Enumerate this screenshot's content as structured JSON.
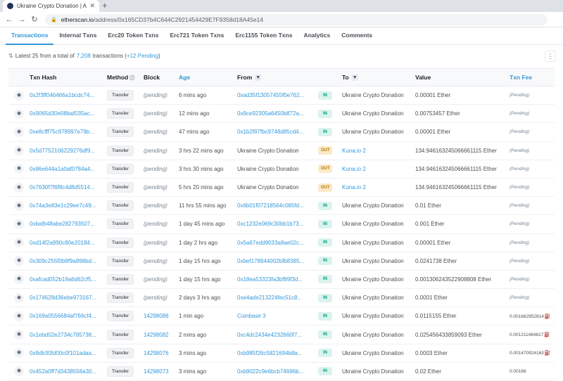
{
  "browser": {
    "tab_title": "Ukraine Crypto Donation | Add",
    "url_host": "etherscan.io",
    "url_path": "/address/0x165CD37b4C644C2921454429E7F9358d18A45e14"
  },
  "nav_tabs": [
    "Transactions",
    "Internal Txns",
    "Erc20 Token Txns",
    "Erc721 Token Txns",
    "Erc1155 Token Txns",
    "Analytics",
    "Comments"
  ],
  "summary": {
    "prefix": "Latest 25 from a total of",
    "total": "7,208",
    "middle": "transactions (",
    "pending": "+12 Pending",
    "suffix": ")"
  },
  "columns": {
    "hash": "Txn Hash",
    "method": "Method",
    "block": "Block",
    "age": "Age",
    "from": "From",
    "to": "To",
    "value": "Value",
    "fee": "Txn Fee"
  },
  "rows": [
    {
      "hash": "0x2f3ff046466a1bcdc74...",
      "method": "Transfer",
      "block": "(pending)",
      "age": "6 mins ago",
      "from": "0xad35f13057455f0e762...",
      "from_link": true,
      "dir": "IN",
      "to": "Ukraine Crypto Donation",
      "to_link": false,
      "value": "0.00001 Ether",
      "fee": "(Pending)",
      "fee_gas": false
    },
    {
      "hash": "0x9065d30e08baf035ac...",
      "method": "Transfer",
      "block": "(pending)",
      "age": "12 mins ago",
      "from": "0x9ce92305a6450b872a...",
      "from_link": true,
      "dir": "IN",
      "to": "Ukraine Crypto Donation",
      "to_link": false,
      "value": "0.00753457 Ether",
      "fee": "(Pending)",
      "fee_gas": false
    },
    {
      "hash": "0xe8cfff75c978997e79b...",
      "method": "Transfer",
      "block": "(pending)",
      "age": "47 mins ago",
      "from": "0x1b2f87fbc9748d85cd4...",
      "from_link": true,
      "dir": "IN",
      "to": "Ukraine Crypto Donation",
      "to_link": false,
      "value": "0.00001 Ether",
      "fee": "(Pending)",
      "fee_gas": false
    },
    {
      "hash": "0x5d7752106229276df9...",
      "method": "Transfer",
      "block": "(pending)",
      "age": "3 hrs 22 mins ago",
      "from": "Ukraine Crypto Donation",
      "from_link": false,
      "dir": "OUT",
      "to": "Kuna.io 2",
      "to_link": true,
      "value": "134.946163245066661115 Ether",
      "fee": "(Pending)",
      "fee_gas": false
    },
    {
      "hash": "0x86e644a1a0af0784a4...",
      "method": "Transfer",
      "block": "(pending)",
      "age": "3 hrs 30 mins ago",
      "from": "Ukraine Crypto Donation",
      "from_link": false,
      "dir": "OUT",
      "to": "Kuna.io 2",
      "to_link": true,
      "value": "134.946163245066661115 Ether",
      "fee": "(Pending)",
      "fee_gas": false
    },
    {
      "hash": "0x7630f7f6f8c4d8d5514...",
      "method": "Transfer",
      "block": "(pending)",
      "age": "5 hrs 20 mins ago",
      "from": "Ukraine Crypto Donation",
      "from_link": false,
      "dir": "OUT",
      "to": "Kuna.io 2",
      "to_link": true,
      "value": "134.946163245066661115 Ether",
      "fee": "(Pending)",
      "fee_gas": false
    },
    {
      "hash": "0x74a3e83e1c29ee7c49...",
      "method": "Transfer",
      "block": "(pending)",
      "age": "11 hrs 55 mins ago",
      "from": "0x6b01f07218564c085fd...",
      "from_link": true,
      "dir": "IN",
      "to": "Ukraine Crypto Donation",
      "to_link": false,
      "value": "0.01 Ether",
      "fee": "(Pending)",
      "fee_gas": false
    },
    {
      "hash": "0xbafb48abe282793507...",
      "method": "Transfer",
      "block": "(pending)",
      "age": "1 day 45 mins ago",
      "from": "0xc1232e069c30bb1b73...",
      "from_link": true,
      "dir": "IN",
      "to": "Ukraine Crypto Donation",
      "to_link": false,
      "value": "0.001 Ether",
      "fee": "(Pending)",
      "fee_gas": false
    },
    {
      "hash": "0xd14f2a990c80e20184...",
      "method": "Transfer",
      "block": "(pending)",
      "age": "1 day 2 hrs ago",
      "from": "0x5a67edd9033a8ae02c...",
      "from_link": true,
      "dir": "IN",
      "to": "Ukraine Crypto Donation",
      "to_link": false,
      "value": "0.00001 Ether",
      "fee": "(Pending)",
      "fee_gas": false
    },
    {
      "hash": "0x309c255f0b9f9a898bd...",
      "method": "Transfer",
      "block": "(pending)",
      "age": "1 day 15 hrs ago",
      "from": "0xbef178944002bfb8385...",
      "from_link": true,
      "dir": "IN",
      "to": "Ukraine Crypto Donation",
      "to_link": false,
      "value": "0.0241738 Ether",
      "fee": "(Pending)",
      "fee_gas": false
    },
    {
      "hash": "0xafcad052b19a6d62cf5...",
      "method": "Transfer",
      "block": "(pending)",
      "age": "1 day 15 hrs ago",
      "from": "0x18ea53323fa3bf89f3d...",
      "from_link": true,
      "dir": "IN",
      "to": "Ukraine Crypto Donation",
      "to_link": false,
      "value": "0.001306243522908808 Ether",
      "fee": "(Pending)",
      "fee_gas": false
    },
    {
      "hash": "0x174628d36ebe973167...",
      "method": "Transfer",
      "block": "(pending)",
      "age": "2 days 3 hrs ago",
      "from": "0xe4ade213224fec51c8...",
      "from_link": true,
      "dir": "IN",
      "to": "Ukraine Crypto Donation",
      "to_link": false,
      "value": "0.0001 Ether",
      "fee": "(Pending)",
      "fee_gas": false
    },
    {
      "hash": "0x169a0556684af766cf4...",
      "method": "Transfer",
      "block": "14298086",
      "age": "1 min ago",
      "from": "Coinbase 3",
      "from_link": true,
      "dir": "IN",
      "to": "Ukraine Crypto Donation",
      "to_link": false,
      "value": "0.0115155 Ether",
      "fee": "0.001682952814",
      "fee_gas": true
    },
    {
      "hash": "0x1ebd02e2734c795738...",
      "method": "Transfer",
      "block": "14298082",
      "age": "2 mins ago",
      "from": "0xc4dc2434e4232660f7...",
      "from_link": true,
      "dir": "IN",
      "to": "Ukraine Crypto Donation",
      "to_link": false,
      "value": "0.025456433859093 Ether",
      "fee": "0.001211484817",
      "fee_gas": true
    },
    {
      "hash": "0x8db30fd00c0f101adaa...",
      "method": "Transfer",
      "block": "14298076",
      "age": "3 mins ago",
      "from": "0xb985f26c5821694b8a...",
      "from_link": true,
      "dir": "IN",
      "to": "Ukraine Crypto Donation",
      "to_link": false,
      "value": "0.0003 Ether",
      "fee": "0.001470924163",
      "fee_gas": true
    },
    {
      "hash": "0x452a0ff7d3438558a30...",
      "method": "Transfer",
      "block": "14298073",
      "age": "3 mins ago",
      "from": "0xb9022c9e6bcb74696b...",
      "from_link": true,
      "dir": "IN",
      "to": "Ukraine Crypto Donation",
      "to_link": false,
      "value": "0.02 Ether",
      "fee": "0.00168",
      "fee_gas": false
    }
  ]
}
